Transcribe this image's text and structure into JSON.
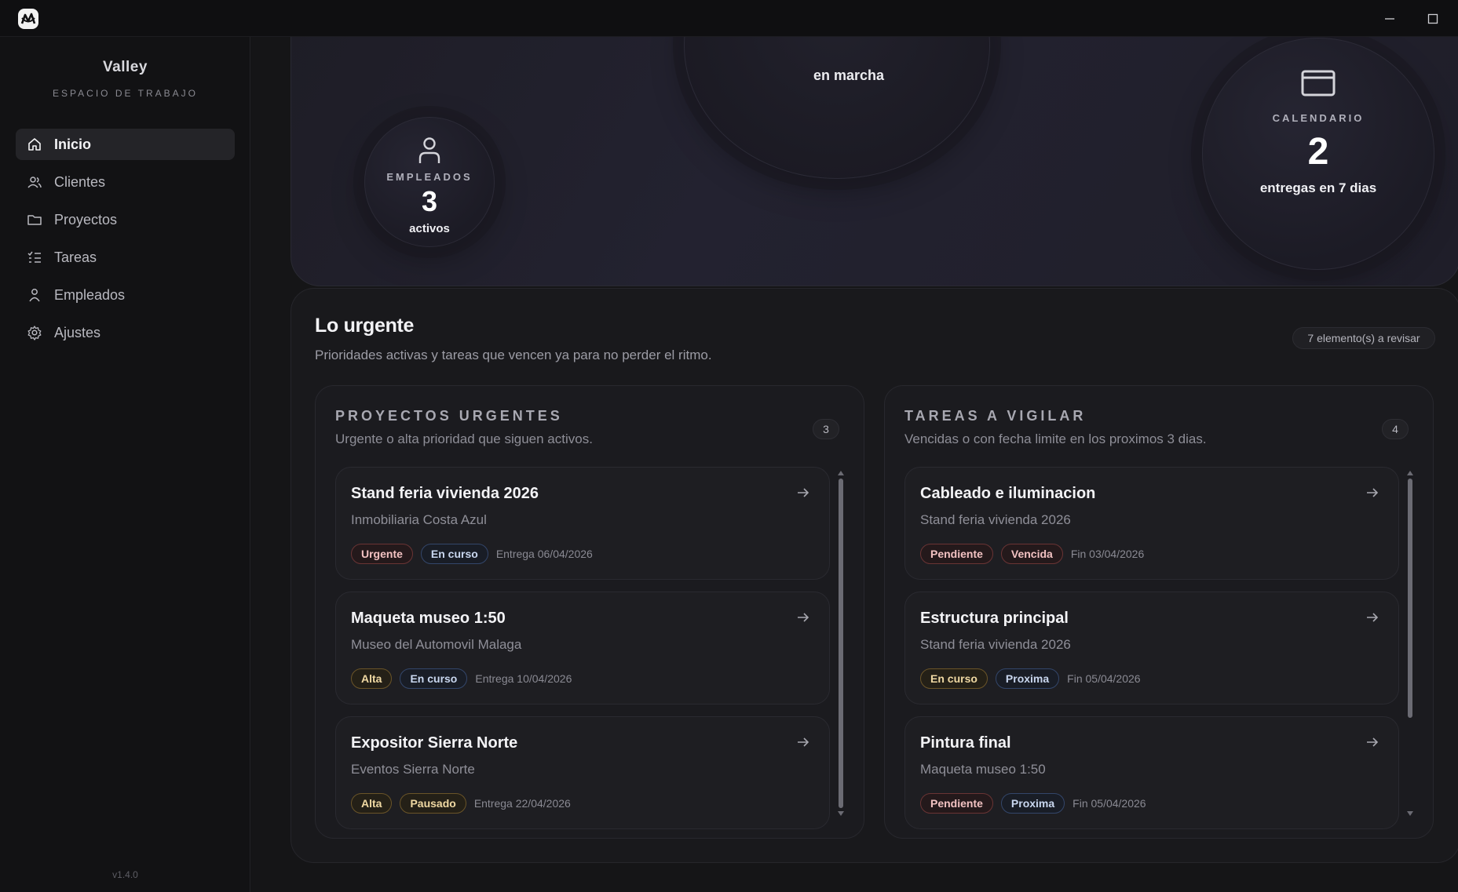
{
  "window": {
    "minimize_icon": "minimize-icon",
    "maximize_icon": "maximize-icon"
  },
  "sidebar": {
    "brand": "Valley",
    "workspace": "ESPACIO DE TRABAJO",
    "items": [
      {
        "label": "Inicio",
        "icon": "home-icon",
        "active": true
      },
      {
        "label": "Clientes",
        "icon": "users-icon",
        "active": false
      },
      {
        "label": "Proyectos",
        "icon": "folder-icon",
        "active": false
      },
      {
        "label": "Tareas",
        "icon": "checklist-icon",
        "active": false
      },
      {
        "label": "Empleados",
        "icon": "user-icon",
        "active": false
      },
      {
        "label": "Ajustes",
        "icon": "gear-icon",
        "active": false
      }
    ],
    "version": "v1.4.0"
  },
  "hero": {
    "middle_sub": "en marcha",
    "employees": {
      "label": "EMPLEADOS",
      "value": "3",
      "sub": "activos",
      "icon": "person-icon"
    },
    "calendar": {
      "label": "CALENDARIO",
      "value": "2",
      "sub": "entregas en 7 dias",
      "icon": "calendar-icon"
    }
  },
  "urgent": {
    "title": "Lo urgente",
    "subtitle": "Prioridades activas y tareas que vencen ya para no perder el ritmo.",
    "badge": "7 elemento(s) a revisar",
    "projects": {
      "heading": "PROYECTOS URGENTES",
      "subtitle": "Urgente o alta prioridad que siguen activos.",
      "count": "3",
      "cards": [
        {
          "title": "Stand feria vivienda 2026",
          "sub": "Inmobiliaria Costa Azul",
          "tags": [
            {
              "text": "Urgente",
              "tone": "red"
            },
            {
              "text": "En curso",
              "tone": "blue"
            }
          ],
          "date": "Entrega 06/04/2026"
        },
        {
          "title": "Maqueta museo 1:50",
          "sub": "Museo del Automovil Malaga",
          "tags": [
            {
              "text": "Alta",
              "tone": "gold"
            },
            {
              "text": "En curso",
              "tone": "blue"
            }
          ],
          "date": "Entrega 10/04/2026"
        },
        {
          "title": "Expositor Sierra Norte",
          "sub": "Eventos Sierra Norte",
          "tags": [
            {
              "text": "Alta",
              "tone": "gold"
            },
            {
              "text": "Pausado",
              "tone": "gold"
            }
          ],
          "date": "Entrega 22/04/2026"
        }
      ]
    },
    "tasks": {
      "heading": "TAREAS A VIGILAR",
      "subtitle": "Vencidas o con fecha limite en los proximos 3 dias.",
      "count": "4",
      "cards": [
        {
          "title": "Cableado e iluminacion",
          "sub": "Stand feria vivienda 2026",
          "tags": [
            {
              "text": "Pendiente",
              "tone": "red"
            },
            {
              "text": "Vencida",
              "tone": "red"
            }
          ],
          "date": "Fin 03/04/2026"
        },
        {
          "title": "Estructura principal",
          "sub": "Stand feria vivienda 2026",
          "tags": [
            {
              "text": "En curso",
              "tone": "gold"
            },
            {
              "text": "Proxima",
              "tone": "blue"
            }
          ],
          "date": "Fin 05/04/2026"
        },
        {
          "title": "Pintura final",
          "sub": "Maqueta museo 1:50",
          "tags": [
            {
              "text": "Pendiente",
              "tone": "red"
            },
            {
              "text": "Proxima",
              "tone": "blue"
            }
          ],
          "date": "Fin 05/04/2026"
        }
      ]
    }
  },
  "colors": {
    "background": "#151517",
    "sidebar": "#121214",
    "active_nav": "#242428",
    "red_tag": "#6a3434",
    "blue_tag": "#33466a",
    "gold_tag": "#6a5428"
  }
}
